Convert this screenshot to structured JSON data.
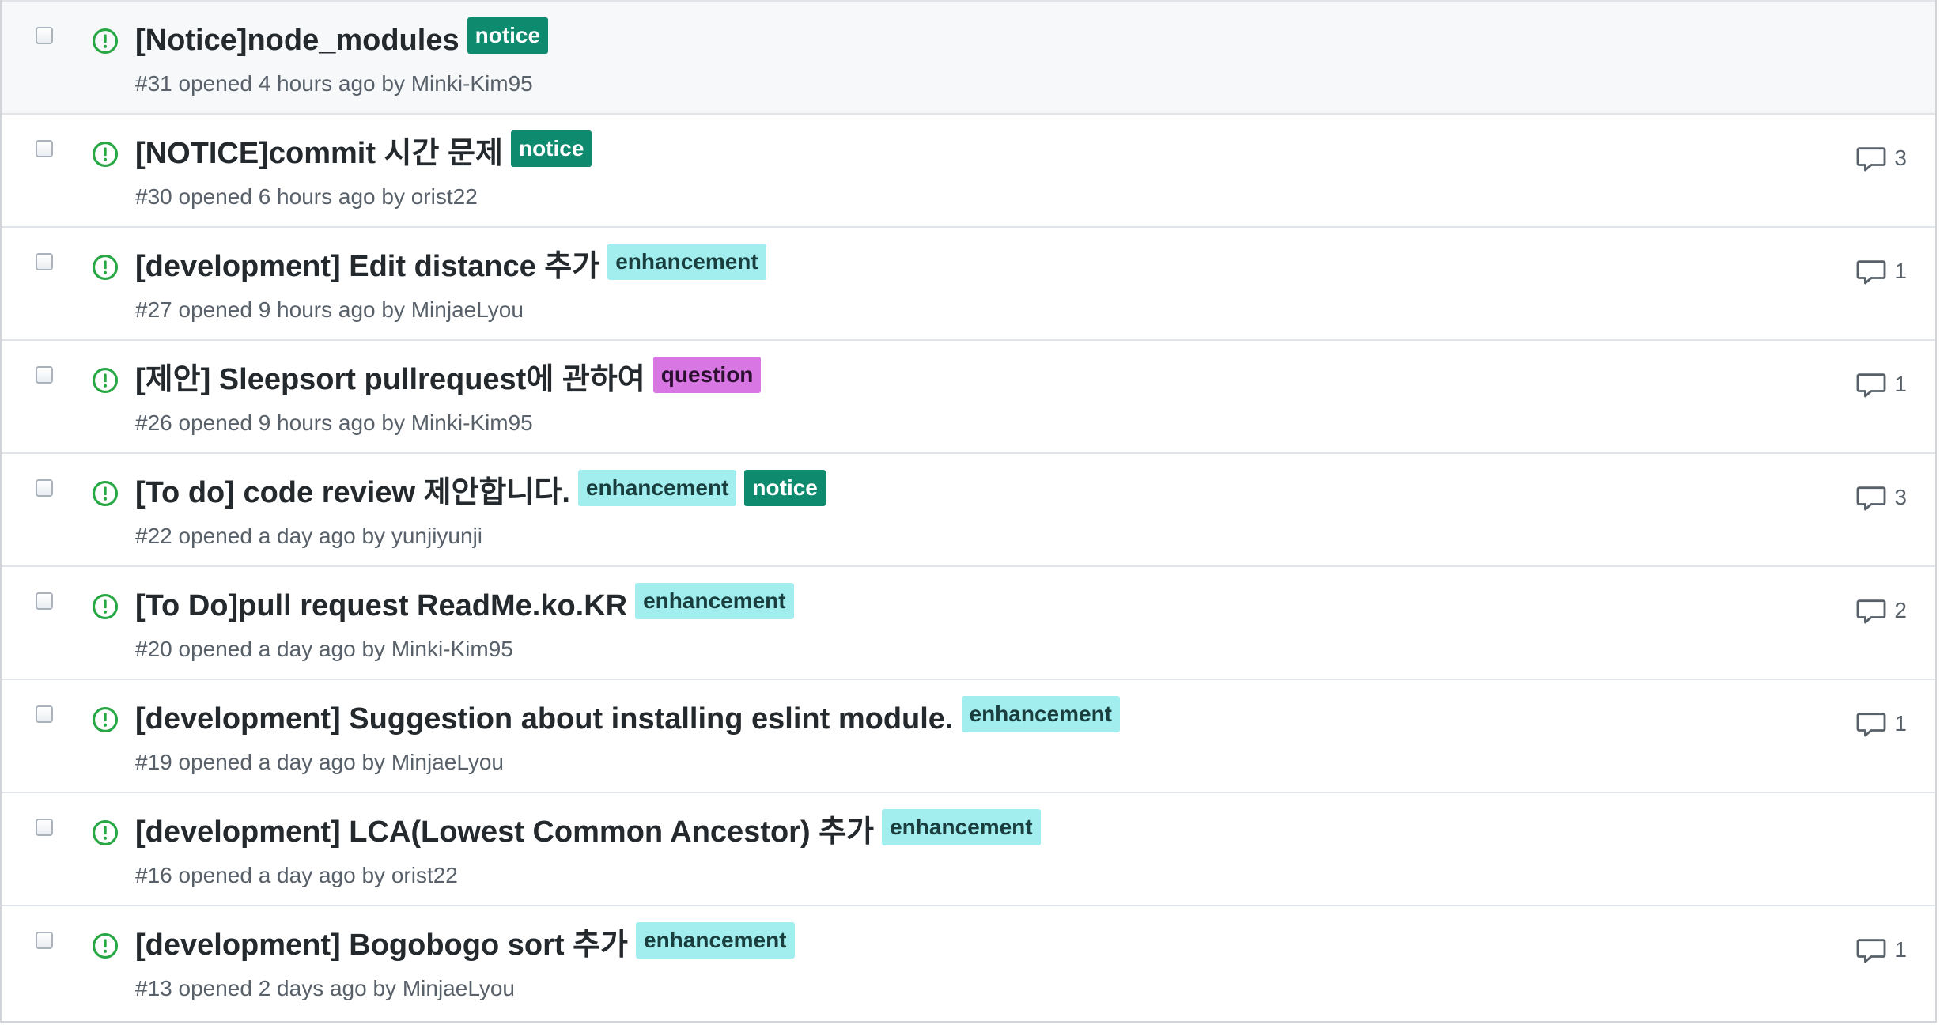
{
  "colors": {
    "notice_bg": "#0e8a6e",
    "notice_fg": "#ffffff",
    "enhancement_bg": "#a2eeef",
    "enhancement_fg": "#1a3d3e",
    "question_bg": "#d876e3",
    "question_fg": "#2b1030",
    "open_icon": "#28a745"
  },
  "issues": [
    {
      "title": "[Notice]node_modules",
      "labels": [
        {
          "name": "notice",
          "kind": "notice"
        }
      ],
      "meta": "#31 opened 4 hours ago by Minki-Kim95",
      "comments": ""
    },
    {
      "title": "[NOTICE]commit 시간 문제",
      "labels": [
        {
          "name": "notice",
          "kind": "notice"
        }
      ],
      "meta": "#30 opened 6 hours ago by orist22",
      "comments": "3"
    },
    {
      "title": "[development] Edit distance 추가",
      "labels": [
        {
          "name": "enhancement",
          "kind": "enhancement"
        }
      ],
      "meta": "#27 opened 9 hours ago by MinjaeLyou",
      "comments": "1"
    },
    {
      "title": "[제안] Sleepsort pullrequest에 관하여",
      "labels": [
        {
          "name": "question",
          "kind": "question"
        }
      ],
      "meta": "#26 opened 9 hours ago by Minki-Kim95",
      "comments": "1"
    },
    {
      "title": "[To do] code review 제안합니다.",
      "labels": [
        {
          "name": "enhancement",
          "kind": "enhancement"
        },
        {
          "name": "notice",
          "kind": "notice"
        }
      ],
      "meta": "#22 opened a day ago by yunjiyunji",
      "comments": "3"
    },
    {
      "title": "[To Do]pull request ReadMe.ko.KR",
      "labels": [
        {
          "name": "enhancement",
          "kind": "enhancement"
        }
      ],
      "meta": "#20 opened a day ago by Minki-Kim95",
      "comments": "2"
    },
    {
      "title": "[development] Suggestion about installing eslint module.",
      "labels": [
        {
          "name": "enhancement",
          "kind": "enhancement"
        }
      ],
      "meta": "#19 opened a day ago by MinjaeLyou",
      "comments": "1"
    },
    {
      "title": "[development] LCA(Lowest Common Ancestor) 추가",
      "labels": [
        {
          "name": "enhancement",
          "kind": "enhancement"
        }
      ],
      "meta": "#16 opened a day ago by orist22",
      "comments": ""
    },
    {
      "title": "[development] Bogobogo sort 추가",
      "labels": [
        {
          "name": "enhancement",
          "kind": "enhancement"
        }
      ],
      "meta": "#13 opened 2 days ago by MinjaeLyou",
      "comments": "1"
    }
  ]
}
